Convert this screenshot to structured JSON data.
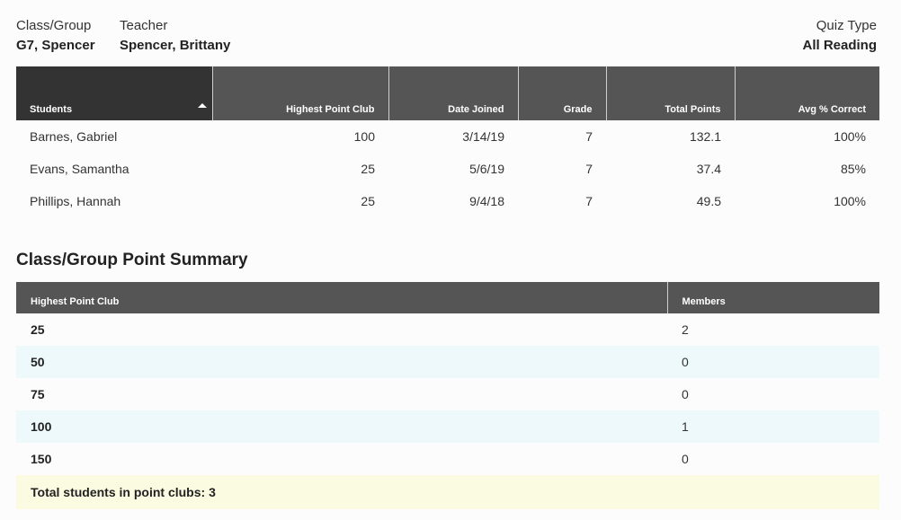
{
  "header": {
    "class_label": "Class/Group",
    "class_value": "G7, Spencer",
    "teacher_label": "Teacher",
    "teacher_value": "Spencer, Brittany",
    "quiz_label": "Quiz Type",
    "quiz_value": "All Reading"
  },
  "students_table": {
    "columns": [
      "Students",
      "Highest Point Club",
      "Date Joined",
      "Grade",
      "Total Points",
      "Avg % Correct"
    ],
    "sort_indicator": "sort-ascending-icon",
    "rows": [
      [
        "Barnes, Gabriel",
        "100",
        "3/14/19",
        "7",
        "132.1",
        "100%"
      ],
      [
        "Evans, Samantha",
        "25",
        "5/6/19",
        "7",
        "37.4",
        "85%"
      ],
      [
        "Phillips, Hannah",
        "25",
        "9/4/18",
        "7",
        "49.5",
        "100%"
      ]
    ]
  },
  "summary": {
    "title": "Class/Group Point Summary",
    "columns": [
      "Highest Point Club",
      "Members"
    ],
    "rows": [
      [
        "25",
        "2"
      ],
      [
        "50",
        "0"
      ],
      [
        "75",
        "0"
      ],
      [
        "100",
        "1"
      ],
      [
        "150",
        "0"
      ]
    ],
    "total": "Total students in point clubs: 3"
  },
  "colors": {
    "header_dark": "#333333",
    "header": "#555555",
    "alt_row": "#eef9fc",
    "total_row": "#fbfbe2"
  }
}
